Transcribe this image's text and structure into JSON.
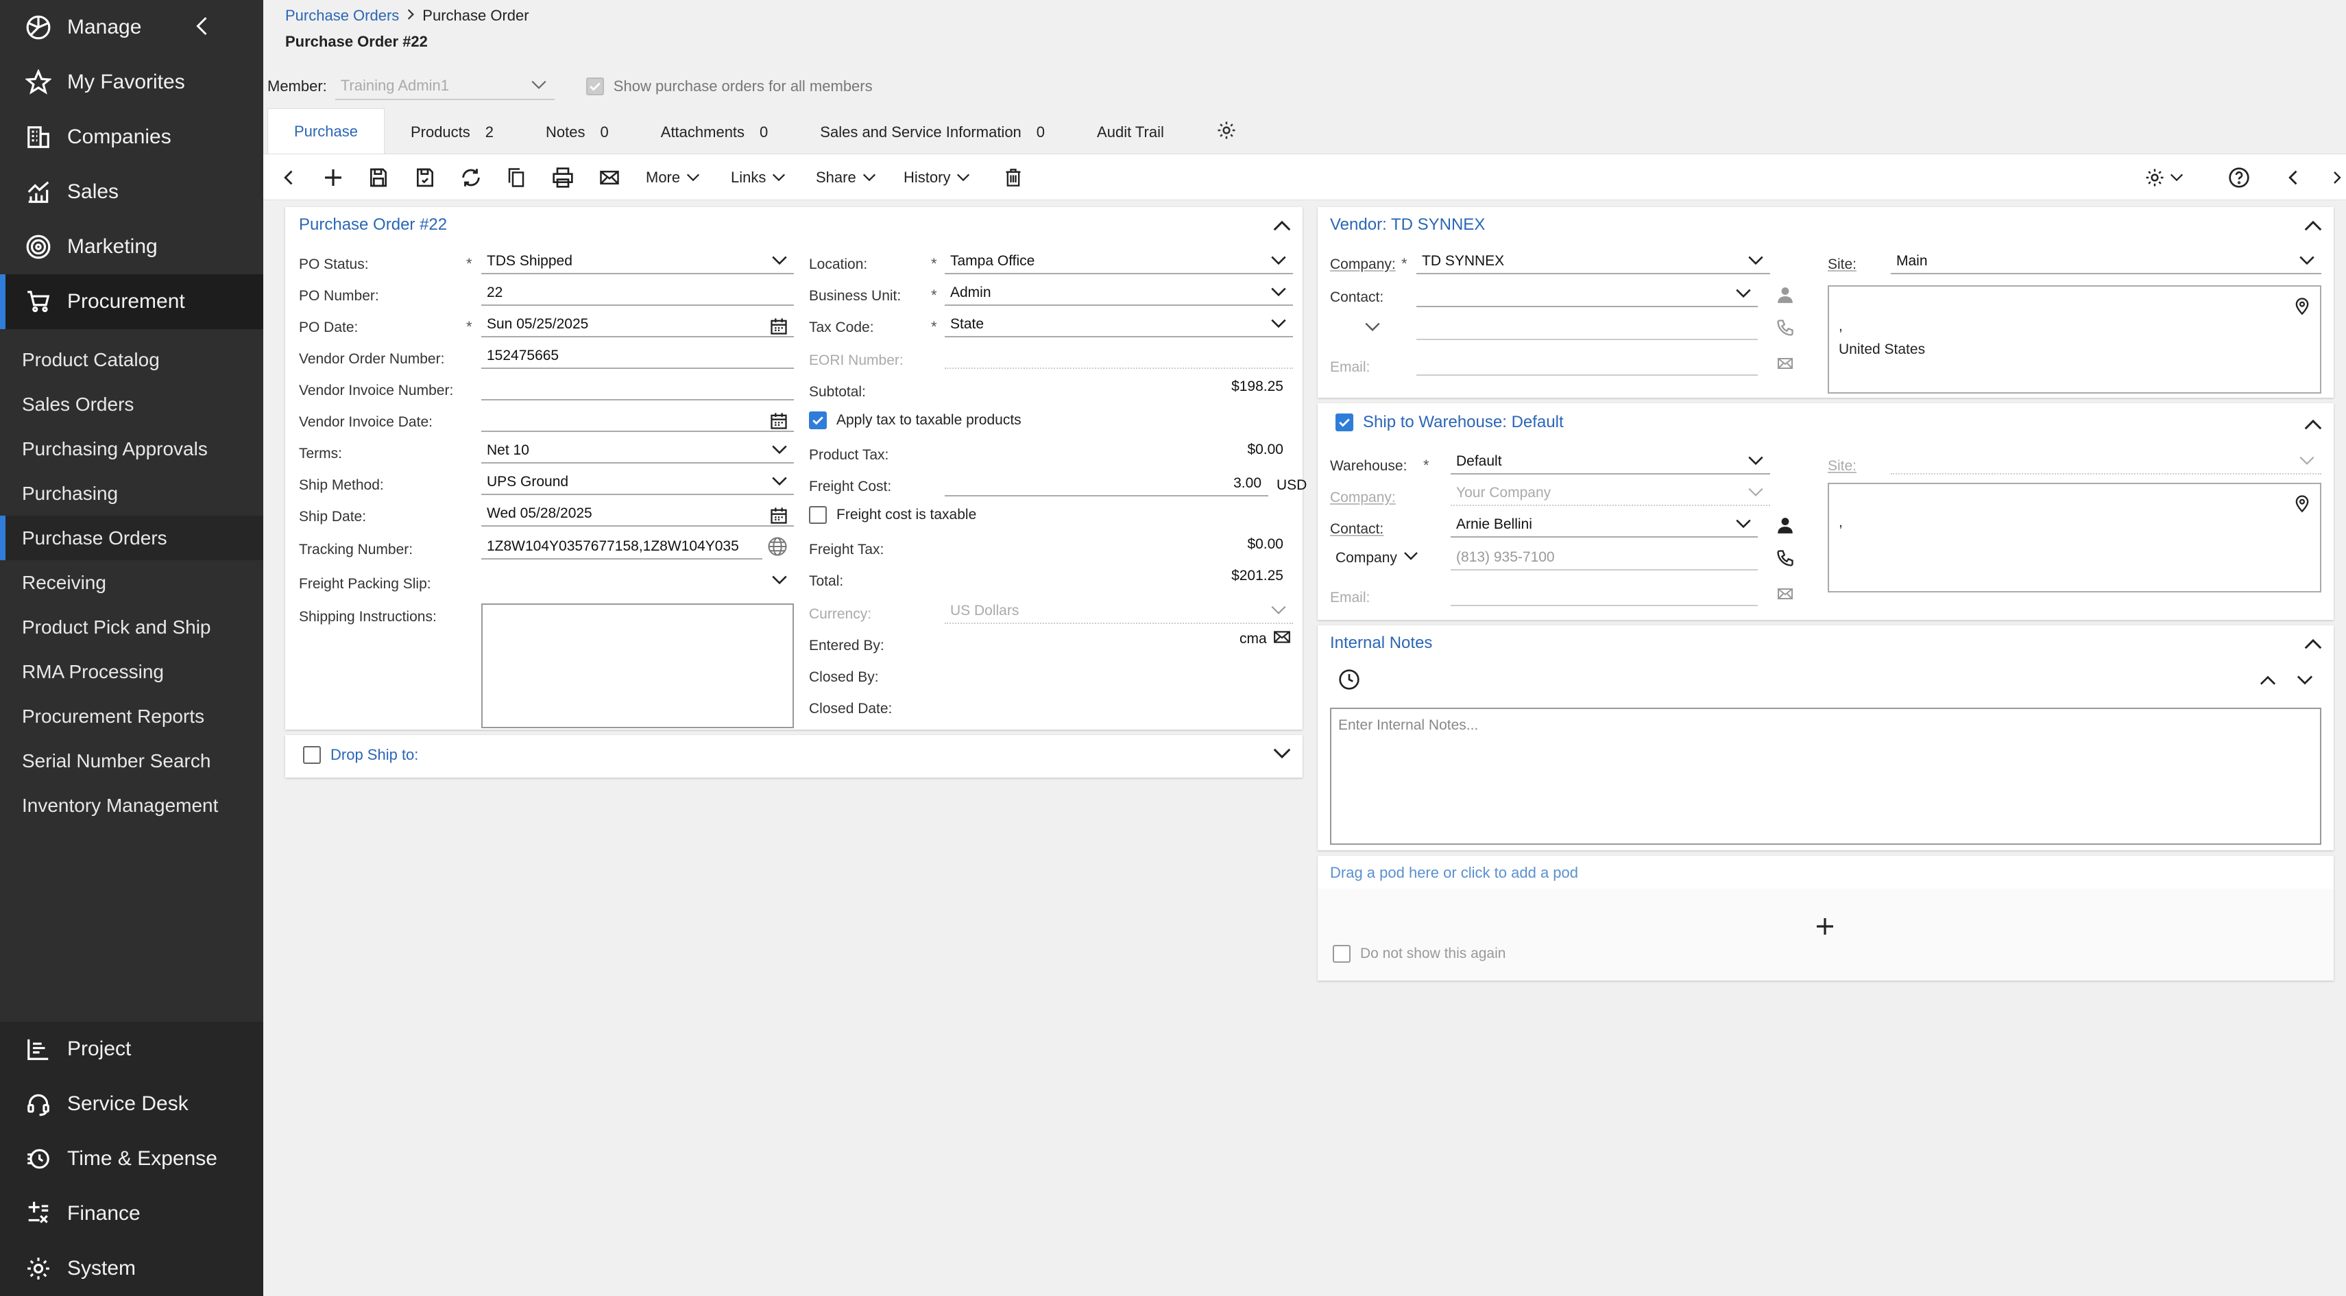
{
  "sidebar": {
    "top_items": [
      {
        "label": "Manage",
        "icon": "manage-icon"
      },
      {
        "label": "My Favorites",
        "icon": "star-icon"
      },
      {
        "label": "Companies",
        "icon": "building-icon"
      },
      {
        "label": "Sales",
        "icon": "chart-icon"
      },
      {
        "label": "Marketing",
        "icon": "target-icon"
      },
      {
        "label": "Procurement",
        "icon": "cart-icon"
      }
    ],
    "sub_items": [
      "Product Catalog",
      "Sales Orders",
      "Purchasing Approvals",
      "Purchasing",
      "Purchase Orders",
      "Receiving",
      "Product Pick and Ship",
      "RMA Processing",
      "Procurement Reports",
      "Serial Number Search",
      "Inventory Management"
    ],
    "bottom_items": [
      {
        "label": "Project",
        "icon": "project-icon"
      },
      {
        "label": "Service Desk",
        "icon": "headset-icon"
      },
      {
        "label": "Time & Expense",
        "icon": "clock-dollar-icon"
      },
      {
        "label": "Finance",
        "icon": "finance-icon"
      },
      {
        "label": "System",
        "icon": "gear-icon"
      }
    ]
  },
  "breadcrumb": {
    "parent": "Purchase Orders",
    "current": "Purchase Order"
  },
  "page_title": "Purchase Order #22",
  "member": {
    "label": "Member:",
    "placeholder": "Training Admin1",
    "show_all_label": "Show purchase orders for all members"
  },
  "tabs": [
    {
      "label": "Purchase",
      "count": ""
    },
    {
      "label": "Products",
      "count": "2"
    },
    {
      "label": "Notes",
      "count": "0"
    },
    {
      "label": "Attachments",
      "count": "0"
    },
    {
      "label": "Sales and Service Information",
      "count": "0"
    },
    {
      "label": "Audit Trail",
      "count": ""
    }
  ],
  "toolbar": {
    "more": "More",
    "links": "Links",
    "share": "Share",
    "history": "History"
  },
  "po": {
    "title": "Purchase Order #22",
    "status_label": "PO Status:",
    "status": "TDS Shipped",
    "number_label": "PO Number:",
    "number": "22",
    "date_label": "PO Date:",
    "date": "Sun 05/25/2025",
    "vendor_order_label": "Vendor Order Number:",
    "vendor_order": "152475665",
    "vendor_invoice_label": "Vendor Invoice Number:",
    "vendor_invoice_date_label": "Vendor Invoice Date:",
    "terms_label": "Terms:",
    "terms": "Net 10",
    "ship_method_label": "Ship Method:",
    "ship_method": "UPS Ground",
    "ship_date_label": "Ship Date:",
    "ship_date": "Wed 05/28/2025",
    "tracking_label": "Tracking Number:",
    "tracking": "1Z8W104Y0357677158,1Z8W104Y035",
    "freight_slip_label": "Freight Packing Slip:",
    "shipping_instructions_label": "Shipping Instructions:",
    "location_label": "Location:",
    "location": "Tampa Office",
    "business_unit_label": "Business Unit:",
    "business_unit": "Admin",
    "tax_code_label": "Tax Code:",
    "tax_code": "State",
    "eori_label": "EORI Number:",
    "subtotal_label": "Subtotal:",
    "subtotal": "$198.25",
    "apply_tax_label": "Apply tax to taxable products",
    "product_tax_label": "Product Tax:",
    "product_tax": "$0.00",
    "freight_cost_label": "Freight Cost:",
    "freight_cost": "3.00",
    "freight_currency": "USD",
    "freight_taxable_label": "Freight cost is taxable",
    "freight_tax_label": "Freight Tax:",
    "freight_tax": "$0.00",
    "total_label": "Total:",
    "total": "$201.25",
    "currency_label": "Currency:",
    "currency": "US Dollars",
    "entered_by_label": "Entered By:",
    "entered_by": "cma",
    "closed_by_label": "Closed By:",
    "closed_date_label": "Closed Date:"
  },
  "drop_ship": {
    "label": "Drop Ship to:"
  },
  "vendor": {
    "title": "Vendor: TD SYNNEX",
    "company_label": "Company:",
    "company": "TD SYNNEX",
    "site_label": "Site:",
    "site": "Main",
    "contact_label": "Contact:",
    "email_label": "Email:",
    "address_line1": ",",
    "address_line2": "United States"
  },
  "warehouse": {
    "title": "Ship to Warehouse: Default",
    "warehouse_label": "Warehouse:",
    "warehouse": "Default",
    "site_label": "Site:",
    "company_label": "Company:",
    "company_placeholder": "Your Company",
    "contact_label": "Contact:",
    "contact": "Arnie Bellini",
    "phone_type": "Company",
    "phone": "(813) 935-7100",
    "email_label": "Email:",
    "address_line1": ","
  },
  "internal_notes": {
    "title": "Internal Notes",
    "placeholder": "Enter Internal Notes..."
  },
  "pod": {
    "add_label": "Drag a pod here or click to add a pod",
    "dont_show": "Do not show this again"
  }
}
